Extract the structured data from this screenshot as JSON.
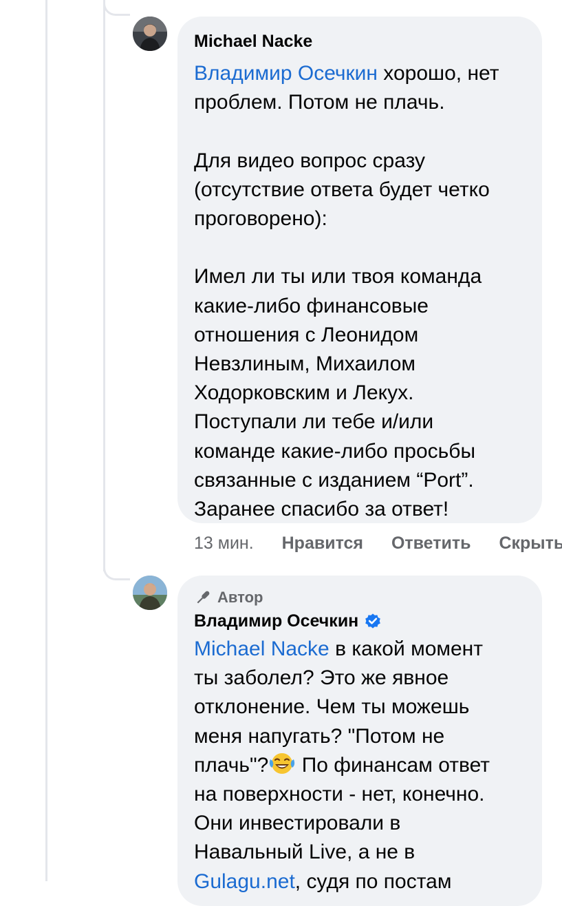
{
  "comments": [
    {
      "author": "Michael Nacke",
      "mention": "Владимир Осечкин",
      "text": " хорошо, нет\nпроблем. Потом не плачь.\n\nДля видео вопрос сразу\n(отсутствие ответа будет четко\nпроговорено):\n\nИмел ли ты или твоя команда\nкакие-либо финансовые\nотношения с Леонидом\nНевзлиным, Михаилом\nХодорковским и Лекух.\nПоступали ли тебе и/или\nкоманде какие-либо просьбы\nсвязанные с изданием “Port”.\nЗаранее спасибо за ответ!",
      "time": "13 мин.",
      "like_label": "Нравится",
      "reply_label": "Ответить",
      "hide_label": "Скрыть"
    },
    {
      "badge": "Автор",
      "author": "Владимир Осечкин",
      "verified": true,
      "mention": "Michael Nacke",
      "text_before_emoji": " в какой момент\nты заболел? Это же явное\nотклонение. Чем ты можешь\nменя напугать? \"Потом не\nплачь\"?",
      "emoji": "face-with-tears-of-joy",
      "text_after_emoji": " По финансам ответ\nна поверхности - нет, конечно.\nОни инвестировали в\nНавальный Live, а не в\n",
      "trailing_mention": "Gulagu.net",
      "trailing_text": ", судя по постам"
    }
  ],
  "colors": {
    "bubble": "#f0f2f5",
    "mention": "#1b6bd1",
    "meta": "#65676b",
    "verified": "#1877f2"
  }
}
